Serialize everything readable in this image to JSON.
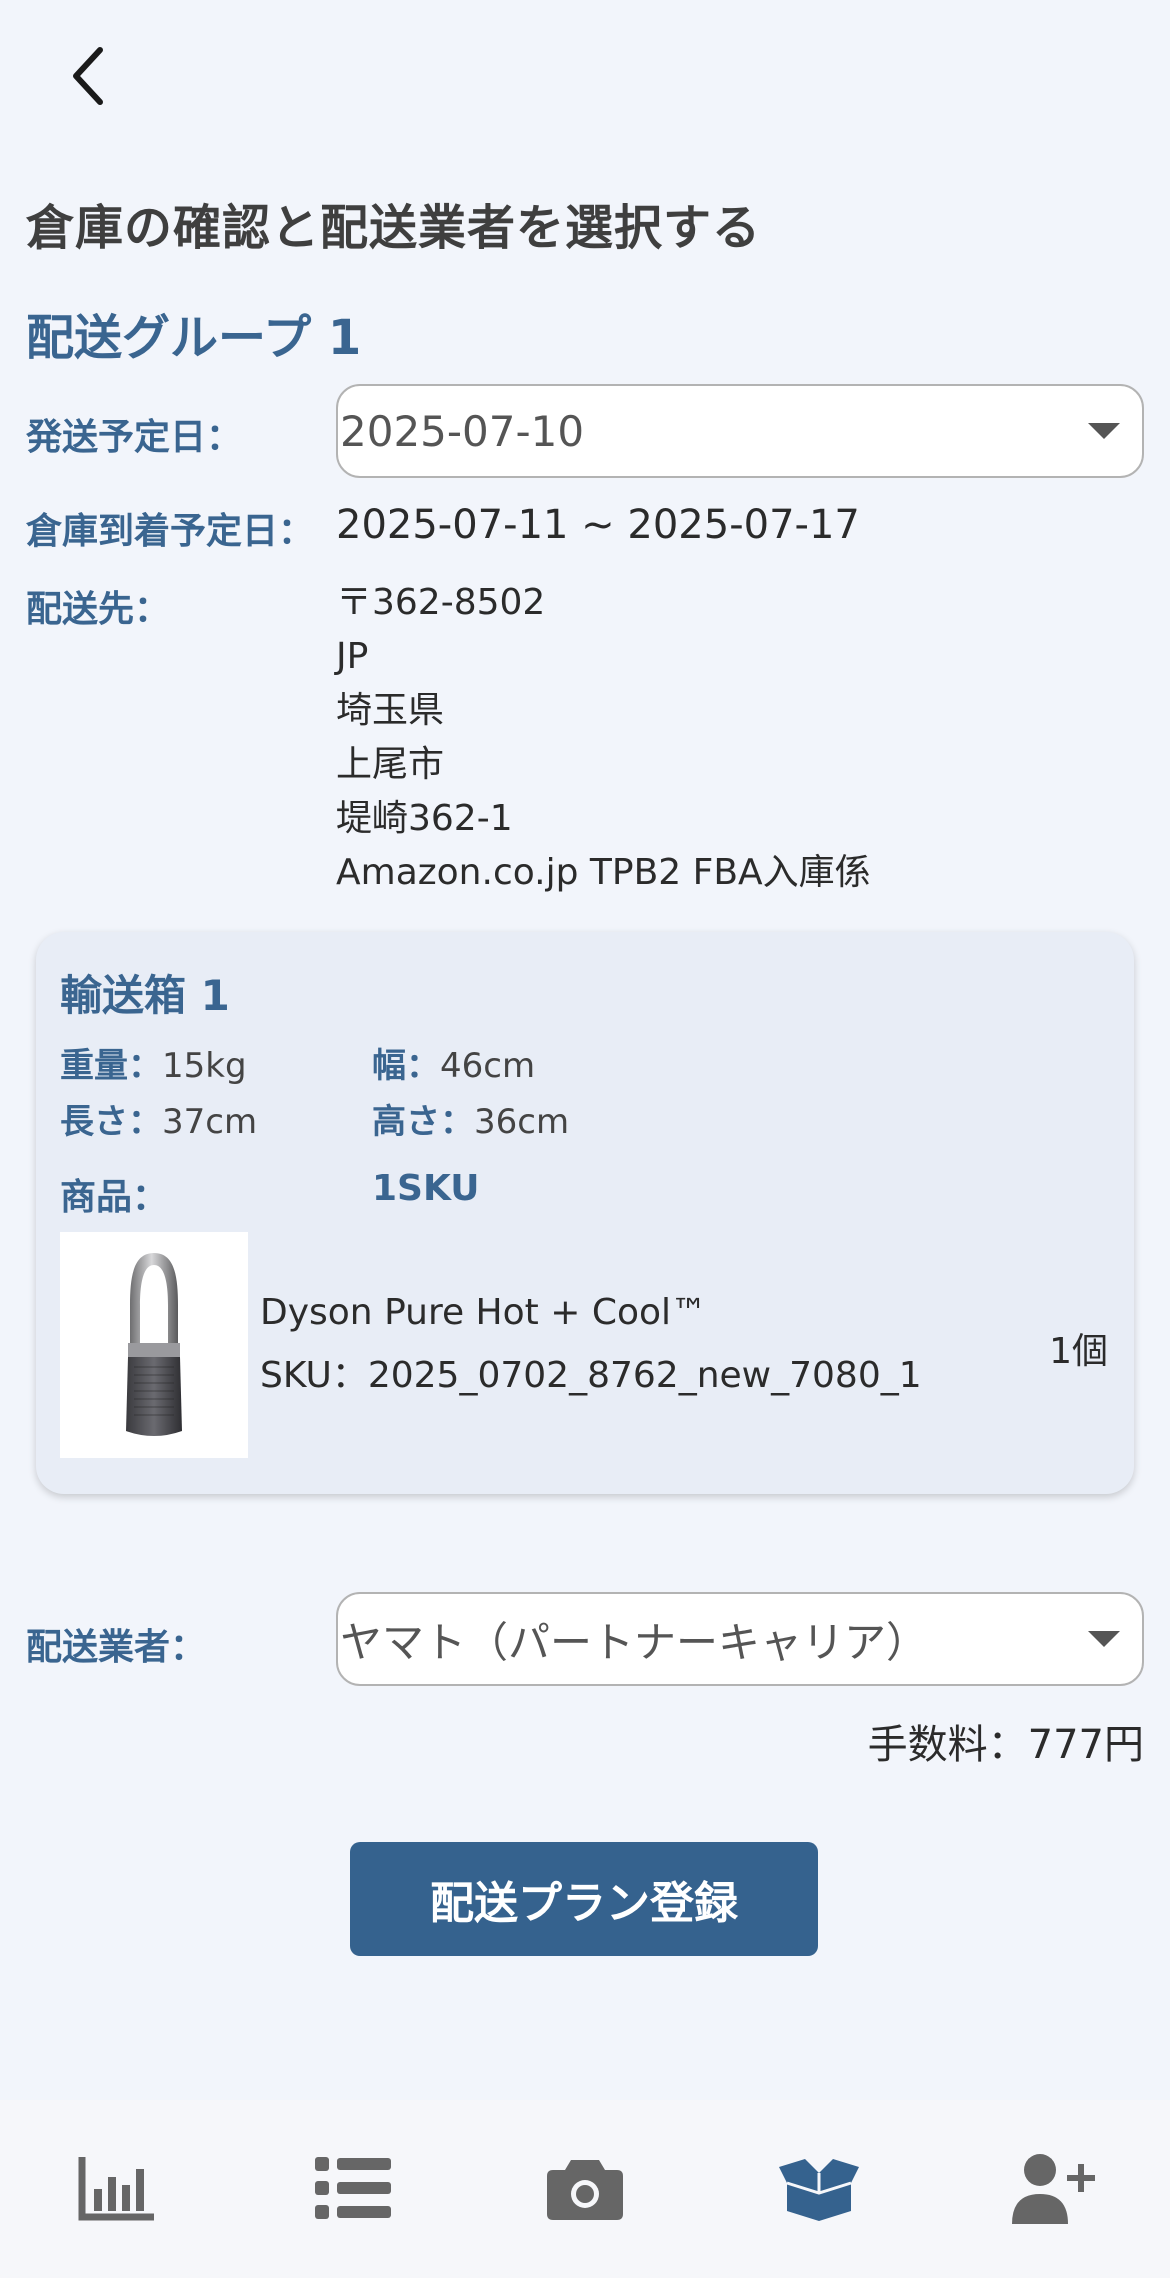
{
  "header": {
    "back_icon": "chevron-left-icon",
    "title": "倉庫の確認と配送業者を選択する"
  },
  "group": {
    "title": "配送グループ 1",
    "ship_date_label": "発送予定日：",
    "ship_date_value": "2025-07-10",
    "arrival_label": "倉庫到着予定日：",
    "arrival_value": "2025-07-11 ~ 2025-07-17",
    "destination_label": "配送先：",
    "address_lines": [
      "〒362-8502",
      "JP",
      "埼玉県",
      "上尾市",
      "堤崎362-1",
      "Amazon.co.jp TPB2 FBA入庫係"
    ]
  },
  "box": {
    "title": "輸送箱 1",
    "weight_label": "重量：",
    "weight_value": "15kg",
    "width_label": "幅：",
    "width_value": "46cm",
    "length_label": "長さ：",
    "length_value": "37cm",
    "height_label": "高さ：",
    "height_value": "36cm",
    "goods_label": "商品：",
    "sku_count": "1SKU",
    "product": {
      "name": "Dyson Pure Hot + Cool™",
      "sku": "SKU：2025_0702_8762_new_7080_1",
      "quantity": "1個"
    }
  },
  "carrier": {
    "label": "配送業者：",
    "value": "ヤマト（パートナーキャリア）"
  },
  "fee": "手数料：777円",
  "submit_label": "配送プラン登録",
  "nav": {
    "items": [
      "chart-icon",
      "list-icon",
      "camera-icon",
      "box-icon",
      "add-user-icon"
    ],
    "active_index": 3,
    "active_color": "#35628e",
    "inactive_color": "#666666"
  },
  "colors": {
    "accent": "#3a6590",
    "button": "#35628e",
    "background": "#f2f5fb",
    "card": "#e8edf6"
  }
}
